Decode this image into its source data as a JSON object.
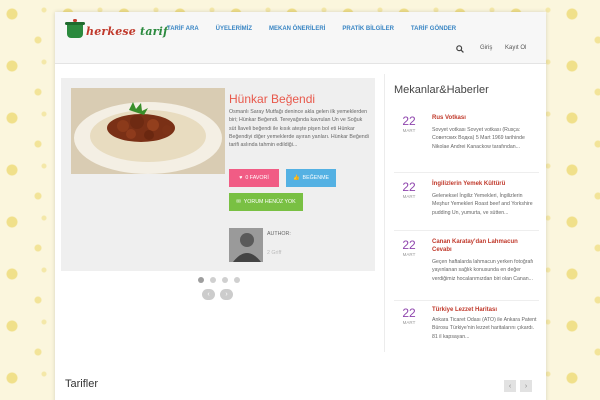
{
  "logo": {
    "part1": "herkese",
    "part2": "tarif"
  },
  "nav": [
    "TARİF ARA",
    "ÜYELERİMİZ",
    "MEKAN ÖNERİLERİ",
    "PRATİK BİLGİLER",
    "TARİF GÖNDER"
  ],
  "header": {
    "login": "Giriş",
    "register": "Kayıt Ol"
  },
  "slider": {
    "title": "Hünkar Beğendi",
    "description": "Osmanlı Saray Mutfağı denince akla gelen ilk yemeklerden biri; Hünkar Beğendi. Tereyağında kavrulan Un ve Soğuk süt İlaveli beğendi ile kısık ateşte pişen bol eti Hünkar Beğendiyi diğer yemeklerde ayıran yanları. Hünkar Beğendi tarifi aslında tahmin edildiği...",
    "fav_label": "0 FAVORİ",
    "like_label": "BEĞENME",
    "comment_label": "YORUM HENÜZ YOK",
    "author_label": "AUTHOR:",
    "author_name": "2 Griff"
  },
  "sidebar": {
    "title": "Mekanlar&Haberler",
    "items": [
      {
        "day": "22",
        "month": "MART",
        "title": "Rus Votkası",
        "text": "Sovyet votkası Sovyet votkası (Rusça: Советских Водка) 5 Mart 1969 tarihinde Nikolae Andrei Kanackow tarafından..."
      },
      {
        "day": "22",
        "month": "MART",
        "title": "İngilizlerin Yemek Kültürü",
        "text": "Geleneksel İngiliz Yemekleri, İngilizlerin Meşhur Yemekleri Roast beef and Yorkshire pudding Un, yumurta, ve sütten..."
      },
      {
        "day": "22",
        "month": "MART",
        "title": "Canan Karatay'dan Lahmacun Cevabı",
        "text": "Geçen haftalarda lahmacun yerken fotoğrafı yayınlanan sağlık konusunda en değer verdiğimiz hocalarımızdan biri olan Canan..."
      },
      {
        "day": "22",
        "month": "MART",
        "title": "Türkiye Lezzet Haritası",
        "text": "Ankara Ticaret Odası (ATO) ile Ankara Patent Bürosu Türkiye'nin lezzet haritalarını çıkardı. 81 il kapsayan..."
      }
    ]
  },
  "recipes": {
    "title": "Tarifler"
  },
  "colors": {
    "accent_red": "#e8584b",
    "nav_blue": "#3a86c4",
    "date_purple": "#8e44ad",
    "fav_pink": "#f15c85",
    "like_blue": "#54b1e3",
    "comment_green": "#79c043"
  },
  "icons": {
    "search": "search-icon",
    "heart": "heart-icon",
    "thumbs": "thumbs-up-icon",
    "comment": "comment-icon",
    "prev": "chevron-left-icon",
    "next": "chevron-right-icon"
  }
}
